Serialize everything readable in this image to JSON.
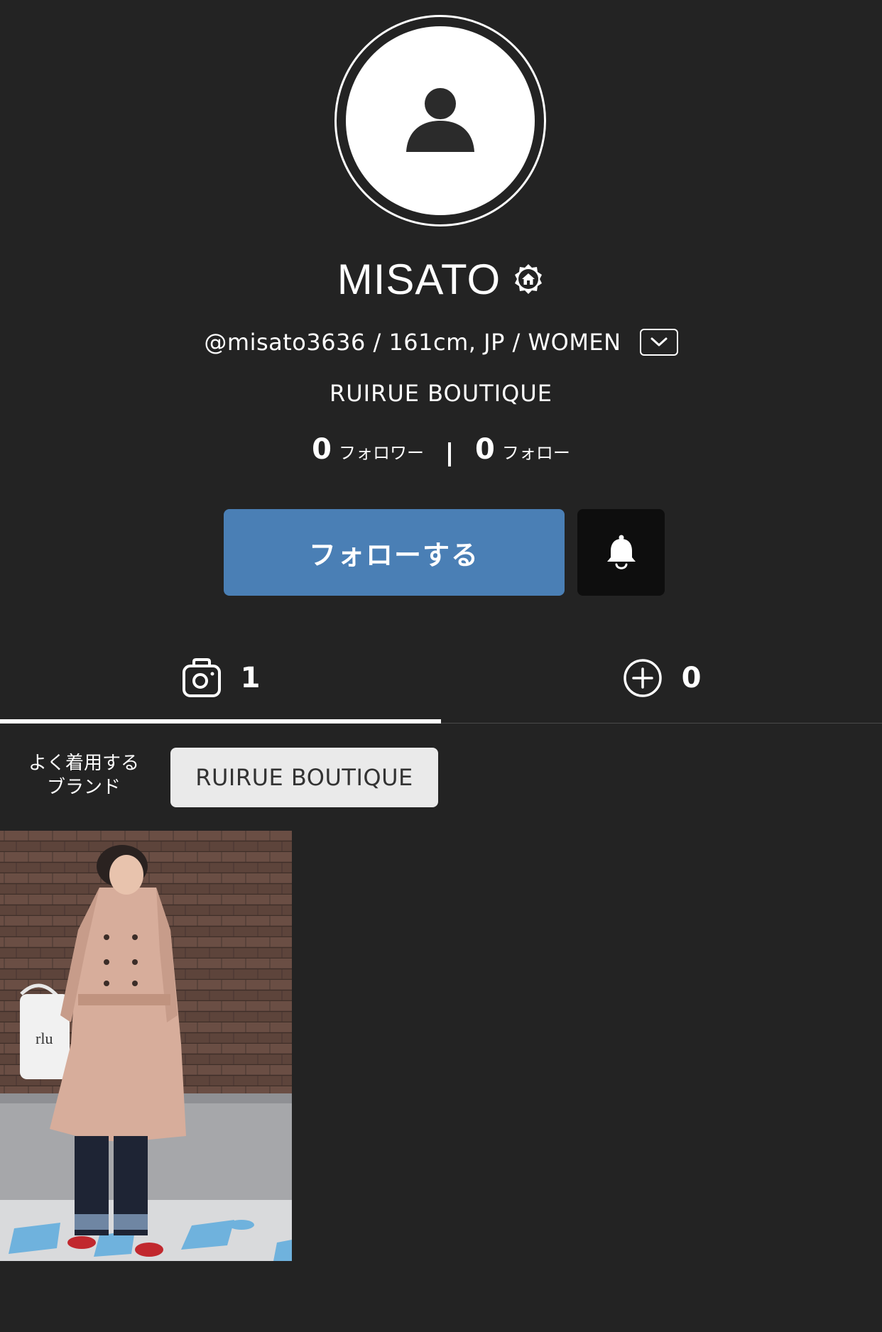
{
  "profile": {
    "name": "MISATO",
    "meta": "@misato3636 / 161cm, JP / WOMEN",
    "shop": "RUIRUE BOUTIQUE"
  },
  "stats": {
    "followers_count": "0",
    "followers_label": "フォロワー",
    "following_count": "0",
    "following_label": "フォロー"
  },
  "actions": {
    "follow_label": "フォローする"
  },
  "tabs": {
    "posts_count": "1",
    "items_count": "0"
  },
  "brands": {
    "label_line1": "よく着用する",
    "label_line2": "ブランド",
    "chip": "RUIRUE BOUTIQUE"
  },
  "colors": {
    "background": "#232323",
    "follow_button": "#4a7fb5",
    "bell_button": "#0e0e0e",
    "brand_chip": "#eaeaea"
  },
  "icons": {
    "avatar": "user-silhouette-icon",
    "shop_badge": "shop-badge-icon",
    "dropdown": "chevron-down-icon",
    "bell": "bell-icon",
    "posts_tab": "camera-icon",
    "items_tab": "plus-circle-icon"
  }
}
